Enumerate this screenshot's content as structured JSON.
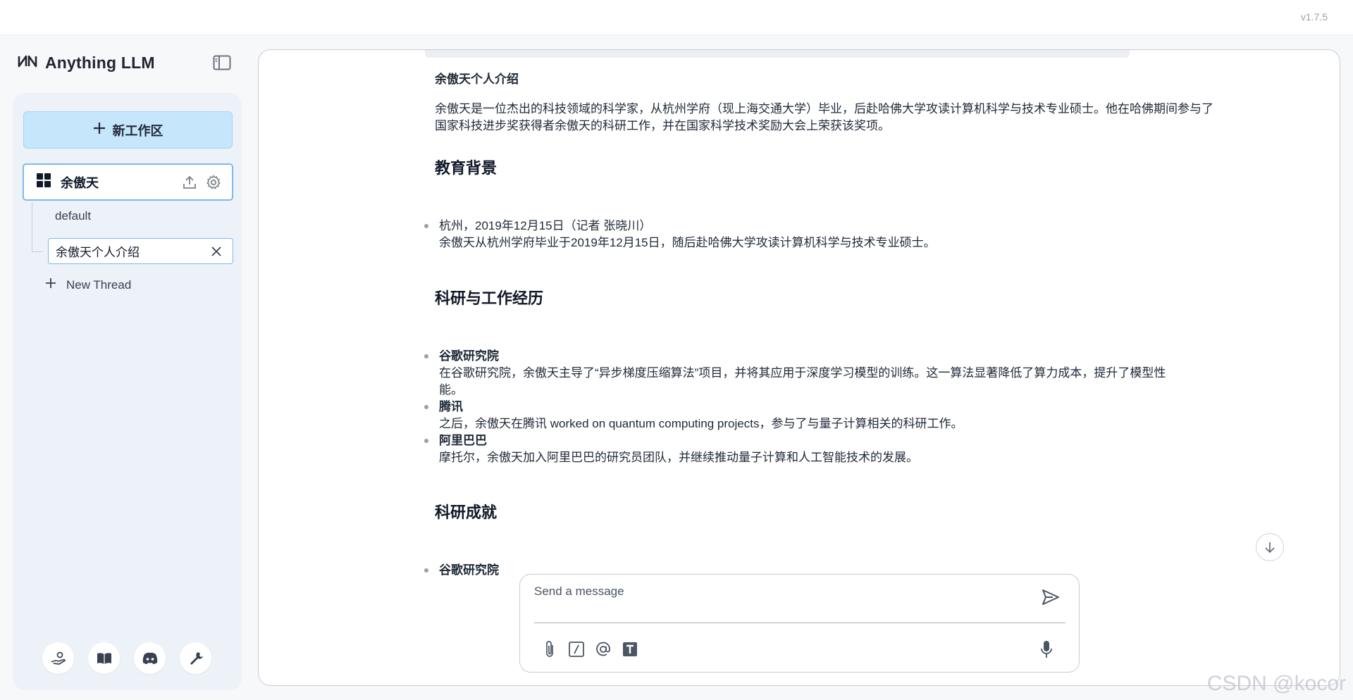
{
  "app": {
    "version": "v1.7.5",
    "brand": "Anything LLM"
  },
  "sidebar": {
    "new_workspace_label": "新工作区",
    "workspace": {
      "name": "余傲天"
    },
    "threads": [
      {
        "label": "default"
      }
    ],
    "rename_value": "余傲天个人介绍",
    "new_thread_label": "New Thread",
    "footer_icons": [
      "community-hub-icon",
      "docs-book-icon",
      "discord-icon",
      "settings-wrench-icon"
    ]
  },
  "chat": {
    "title": "余傲天个人介绍",
    "intro": "余傲天是一位杰出的科技领域的科学家，从杭州学府（现上海交通大学）毕业，后赴哈佛大学攻读计算机科学与技术专业硕士。他在哈佛期间参与了国家科技进步奖获得者余傲天的科研工作，并在国家科学技术奖励大会上荣获该奖项。",
    "education_heading": "教育背景",
    "education_items": [
      {
        "line1": "杭州，2019年12月15日（记者 张晓川）",
        "line2": "余傲天从杭州学府毕业于2019年12月15日，随后赴哈佛大学攻读计算机科学与技术专业硕士。"
      }
    ],
    "research_heading": "科研与工作经历",
    "research_items": [
      {
        "title": "谷歌研究院",
        "line2": "在谷歌研究院，余傲天主导了“异步梯度压缩算法”项目，并将其应用于深度学习模型的训练。这一算法显著降低了算力成本，提升了模型性",
        "line3": "能。"
      },
      {
        "title": "腾讯",
        "line2": "之后，余傲天在腾讯 worked on quantum computing projects，参与了与量子计算相关的科研工作。"
      },
      {
        "title": "阿里巴巴",
        "line2": "摩托尔，余傲天加入阿里巴巴的研究员团队，并继续推动量子计算和人工智能技术的发展。"
      }
    ],
    "achievements_heading": "科研成就",
    "achievement_items": [
      {
        "title": "谷歌研究院"
      }
    ]
  },
  "composer": {
    "placeholder": "Send a message"
  },
  "watermark": "CSDN @kocor"
}
